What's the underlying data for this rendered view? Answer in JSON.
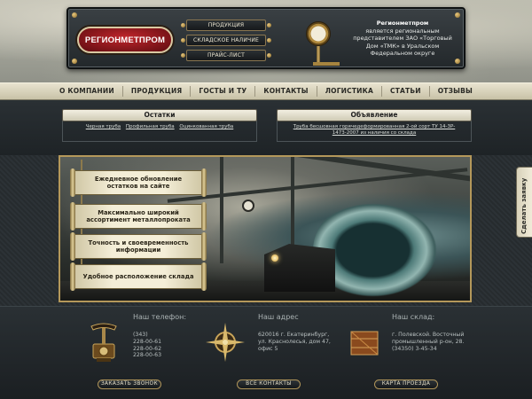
{
  "header": {
    "logo_text": "РЕГИОНМЕТПРОМ",
    "buttons": [
      "ПРОДУКЦИЯ",
      "СКЛАДСКОЕ НАЛИЧИЕ",
      "ПРАЙС-ЛИСТ"
    ],
    "company_name": "Регионметпром",
    "desc_lines": [
      "является региональным",
      "представителем ЗАО «Торговый",
      "Дом «ТМК» в Уральском",
      "Федеральном округе"
    ]
  },
  "nav": [
    "О КОМПАНИИ",
    "ПРОДУКЦИЯ",
    "ГОСТЫ И ТУ",
    "КОНТАКТЫ",
    "ЛОГИСТИКА",
    "СТАТЬИ",
    "ОТЗЫВЫ"
  ],
  "stock": {
    "title": "Остатки",
    "links": [
      "Черная труба",
      "Профильная труба",
      "Оцинкованная труба"
    ]
  },
  "announcement": {
    "title": "Объявление",
    "lines": [
      "Труба бесшовная горячедеформированная 2-ой сорт ТУ 14-3Р-",
      "1473-2007 из наличия со склада"
    ]
  },
  "banner_scrolls": [
    [
      "Ежедневное обновление",
      "остатков на сайте"
    ],
    [
      "Максимально широкий",
      "ассортимент металлопроката"
    ],
    [
      "Точность и своевременность",
      "информации"
    ],
    [
      "Удобное расположение склада"
    ]
  ],
  "side_tab": "Сделать заявку",
  "footer": {
    "phone": {
      "title": "Наш телефон:",
      "lines": [
        "(343)",
        "228-00-61",
        "228-00-62",
        "228-00-63"
      ]
    },
    "address": {
      "title": "Наш адрес",
      "lines": [
        "620016 г. Екатеринбург,",
        "ул. Краснолесья, дом 47,",
        "офис 5"
      ]
    },
    "warehouse": {
      "title": "Наш склад:",
      "lines": [
        "г. Полевской. Восточный",
        "промышленный р-он, 28.",
        "(34350) 3-45-34"
      ]
    },
    "buttons": [
      "ЗАКАЗАТЬ ЗВОНОК",
      "ВСЕ КОНТАКТЫ",
      "КАРТА ПРОЕЗДА"
    ]
  },
  "colors": {
    "logo_red": "#c0262c",
    "brass": "#b4985a",
    "nav_bg": "#e8e3cf",
    "dark_bg": "#1d2327"
  },
  "icons": [
    "gauge-icon",
    "telephone-icon",
    "compass-icon",
    "crate-icon"
  ]
}
